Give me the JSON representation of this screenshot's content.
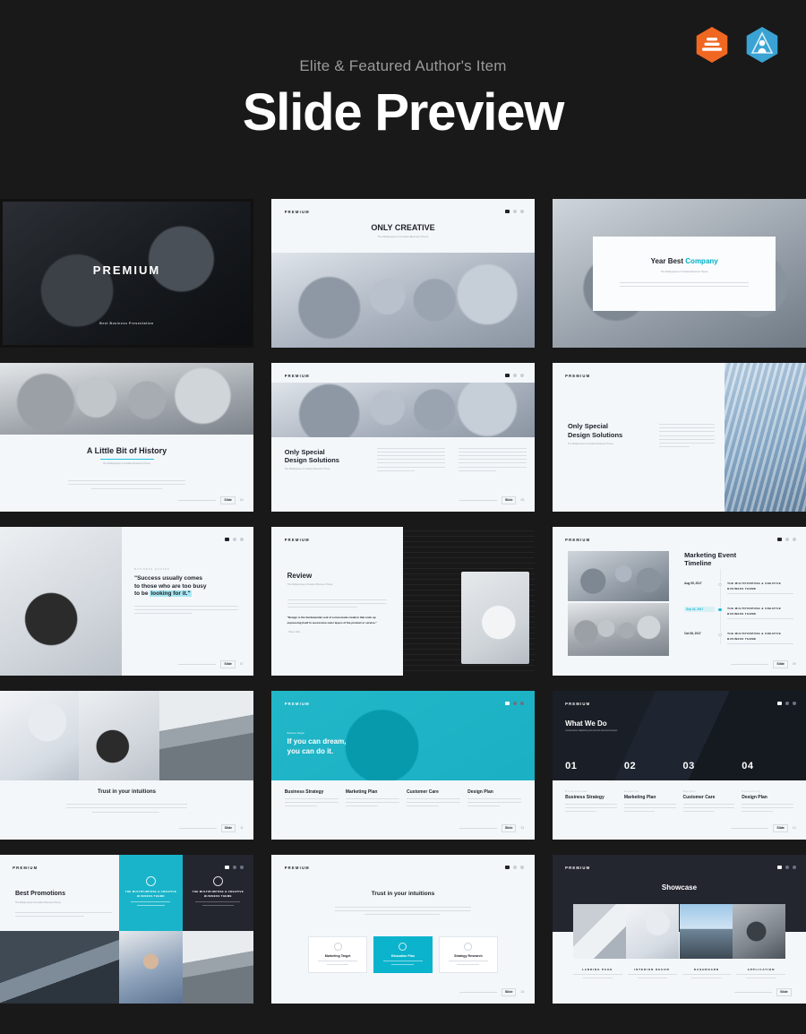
{
  "header": {
    "eyebrow": "Elite & Featured Author's Item",
    "title": "Slide Preview",
    "badges": [
      {
        "name": "elite-badge",
        "color": "#f06722"
      },
      {
        "name": "featured-author-badge",
        "color": "#3aa3d4"
      }
    ]
  },
  "brand": {
    "logo": "PREMIUM",
    "accent": "#00b0c7",
    "dark": "#20232b",
    "page_bg": "#191919"
  },
  "footer": {
    "note": "www.yourwebsite.com",
    "page_label": "Slide",
    "numbers": [
      "02",
      "04",
      "05",
      "07",
      "08",
      "09",
      "11",
      "12",
      "14",
      "15"
    ]
  },
  "slides": [
    {
      "id": "slide-premium-cover",
      "title": "PREMIUM",
      "subtitle": "Best Business Presentation"
    },
    {
      "id": "slide-only-creative",
      "logo": "PREMIUM",
      "title": "ONLY CREATIVE",
      "subtitle": "The Multipurpose & Creative Business Theme"
    },
    {
      "id": "slide-year-best-company",
      "title_1": "Year Best ",
      "title_2": "Company",
      "subtitle": "The Multipurpose & Creative Business Theme",
      "body": "Design is the fundamental soul of a man-made creation that ends up expressing itself in successive outer layers of the product."
    },
    {
      "id": "slide-a-little-bit-of-history",
      "title": "A Little Bit of History",
      "subtitle": "The Multipurpose & Creative Business Theme",
      "body": "Consectetur adipiscing elit sed do eiusmod tempor incididunt ut labore et dolore magna aliqua. Ut enim ad minim veniam quis nostrud exercitation."
    },
    {
      "id": "slide-design-solutions-top-image",
      "logo": "PREMIUM",
      "title_line1": "Only Special",
      "title_line2": "Design Solutions",
      "subtitle": "The Multipurpose & Creative Business Theme",
      "col_left_body": "Consectetur adipiscing elit sed do eiusmod tempor incididunt ut labore et dolore magna aliqua enim minim veniam.",
      "col_right_body": "Quis nostrud exercitation ullamco laboris nisi ut aliquip ex ea commodo consequat duis aute irure dolor."
    },
    {
      "id": "slide-design-solutions-side-image",
      "logo": "PREMIUM",
      "title_line1": "Only Special",
      "title_line2": "Design Solutions",
      "subtitle": "The Multipurpose & Creative Business Theme",
      "body": "Consectetur adipiscing elit sed do eiusmod tempor incididunt ut labore et dolore magna aliqua enim ad minim veniam quis nostrud."
    },
    {
      "id": "slide-success-quote",
      "kicker": "BUSINESS QUOTES",
      "quote_line1": "\"Success usually comes",
      "quote_line2": "to those who are too busy",
      "quote_line3_plain": "to be ",
      "quote_line3_highlight": "looking for it.\"",
      "body": "Consectetur adipiscing elit sed do eiusmod tempor incididunt ut labore et dolore magna aliqua ut enim ad minim veniam quis nostrud exercitation ullamco."
    },
    {
      "id": "slide-review",
      "logo": "PREMIUM",
      "title": "Review",
      "subtitle": "The Multipurpose & Creative Business Theme",
      "body": "Consectetur adipiscing elit sed do eiusmod tempor incididunt ut labore et dolore magna aliqua ut enim ad minim veniam quis nostrud exercitation.",
      "quote": "\"Design is the fundamental soul of a man-made creation that ends up expressing itself in successive outer layers of the product or service.\"",
      "attribution": "- Steve Jobs"
    },
    {
      "id": "slide-marketing-event-timeline",
      "logo": "PREMIUM",
      "title_line1": "Marketing Event",
      "title_line2": "Timeline",
      "events": [
        {
          "date": "Aug 05, 2017",
          "heading_1": "THE MULTIPURPOSE & CREATIVE",
          "heading_2": "BUSINESS THEME",
          "body": "Consectetur adipiscing elit sed do eiusmod tempor incididunt ut labore.",
          "active": false
        },
        {
          "date": "Sep 02, 2017",
          "heading_1": "THE MULTIPURPOSE & CREATIVE",
          "heading_2": "BUSINESS THEME",
          "body": "Consectetur adipiscing elit sed do eiusmod tempor incididunt ut labore.",
          "active": true
        },
        {
          "date": "Oct 08, 2017",
          "heading_1": "THE MULTIPURPOSE & CREATIVE",
          "heading_2": "BUSINESS THEME",
          "body": "Consectetur adipiscing elit sed do eiusmod tempor incididunt ut labore.",
          "active": false
        }
      ]
    },
    {
      "id": "slide-trust-intuitions-photos",
      "title": "Trust in your intuitions",
      "body": "Consectetur adipiscing elit sed do eiusmod tempor incididunt ut labore et dolore magna aliqua ut enim ad minim veniam quis nostrud exercitation ullamco laboris."
    },
    {
      "id": "slide-if-you-can-dream",
      "logo": "PREMIUM",
      "kicker": "Business Slogan",
      "title_line1": "If you can dream,",
      "title_line2": "you can do it.",
      "columns": [
        {
          "title": "Business Strategy",
          "body": "Consectetur adipiscing elit sed do eiusmod tempor incididunt ut labore et dolore."
        },
        {
          "title": "Marketing Plan",
          "body": "Consectetur adipiscing elit sed do eiusmod tempor incididunt ut labore et dolore."
        },
        {
          "title": "Customer Care",
          "body": "Consectetur adipiscing elit sed do eiusmod tempor incididunt ut labore et dolore."
        },
        {
          "title": "Design Plan",
          "body": "Consectetur adipiscing elit sed do eiusmod tempor incididunt ut labore et dolore."
        }
      ]
    },
    {
      "id": "slide-what-we-do",
      "logo": "PREMIUM",
      "title": "What We Do",
      "subtitle": "Consectetur adipiscing elit sed do eiusmod tempor.",
      "numbers": [
        "01",
        "02",
        "03",
        "04"
      ],
      "columns": [
        {
          "kicker": "Professional",
          "title": "Business Strategy",
          "body": "Consectetur adipiscing elit sed do eiusmod tempor incididunt ut labore et dolore."
        },
        {
          "kicker": "Creative",
          "title": "Marketing Plan",
          "body": "Consectetur adipiscing elit sed do eiusmod tempor incididunt ut labore et dolore."
        },
        {
          "kicker": "Support",
          "title": "Customer Care",
          "body": "Consectetur adipiscing elit sed do eiusmod tempor incididunt ut labore et dolore."
        },
        {
          "kicker": "Consulting",
          "title": "Design Plan",
          "body": "Consectetur adipiscing elit sed do eiusmod tempor incididunt ut labore et dolore."
        }
      ]
    },
    {
      "id": "slide-best-promotions",
      "logo": "PREMIUM",
      "title": "Best Promotions",
      "subtitle": "The Multipurpose & Creative Business Theme",
      "body": "Consectetur adipiscing elit sed do eiusmod tempor incididunt ut labore et dolore magna aliqua ut enim ad minim veniam quis nostrud.",
      "tiles": [
        {
          "icon": "target-icon",
          "heading_1": "THE MULTIPURPOSE & CREATIVE",
          "heading_2": "BUSINESS THEME",
          "body": "Consectetur adipiscing elit sed do eiusmod tempor incididunt ut labore."
        },
        {
          "icon": "glass-icon",
          "heading_1": "THE MULTIPURPOSE & CREATIVE",
          "heading_2": "BUSINESS THEME",
          "body": "Consectetur adipiscing elit sed do eiusmod tempor incididunt ut labore."
        }
      ]
    },
    {
      "id": "slide-trust-intuitions-cards",
      "logo": "PREMIUM",
      "title": "Trust in your intuitions",
      "body": "Consectetur adipiscing elit sed do eiusmod tempor incididunt ut labore et dolore magna aliqua ut enim ad minim veniam quis nostrud exercitation ullamco laboris.",
      "cards": [
        {
          "icon": "target-icon",
          "title": "Marketing Target",
          "body": "Consectetur adipiscing elit sed do eiusmod tempor incididunt ut labore.",
          "active": false
        },
        {
          "icon": "education-icon",
          "title": "Education Plan",
          "body": "Consectetur adipiscing elit sed do eiusmod tempor incididunt ut labore.",
          "active": true
        },
        {
          "icon": "research-icon",
          "title": "Strategy Research",
          "body": "Consectetur adipiscing elit sed do eiusmod tempor incididunt ut labore.",
          "active": false
        }
      ]
    },
    {
      "id": "slide-showcase",
      "logo": "PREMIUM",
      "title": "Showcase",
      "items": [
        {
          "label": "LANDING PAGE",
          "body": "Consectetur adipiscing elit sed do eiusmod tempor incididunt ut labore."
        },
        {
          "label": "INTERIOR DECOR",
          "body": "Consectetur adipiscing elit sed do eiusmod tempor incididunt ut labore."
        },
        {
          "label": "DASHBOARD",
          "body": "Consectetur adipiscing elit sed do eiusmod tempor incididunt ut labore."
        },
        {
          "label": "APPLICATION",
          "body": "Consectetur adipiscing elit sed do eiusmod tempor incididunt ut labore."
        }
      ]
    }
  ]
}
